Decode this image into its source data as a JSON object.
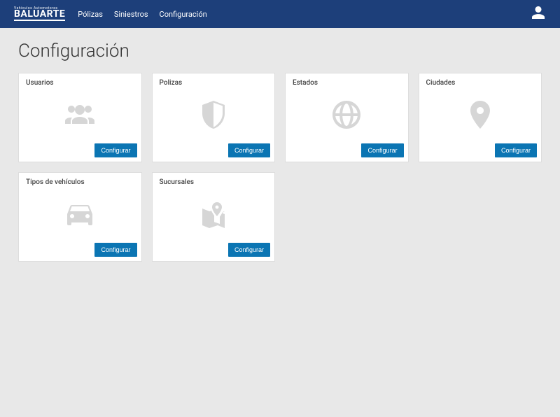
{
  "navbar": {
    "logo_top": "Vehículos Automotores",
    "logo_main": "BALUARTE",
    "links": [
      {
        "label": "Pólizas"
      },
      {
        "label": "Siniestros"
      },
      {
        "label": "Configuración"
      }
    ]
  },
  "page": {
    "title": "Configuración"
  },
  "cards": [
    {
      "title": "Usuarios",
      "icon": "users",
      "button": "Configurar"
    },
    {
      "title": "Polizas",
      "icon": "shield",
      "button": "Configurar"
    },
    {
      "title": "Estados",
      "icon": "globe",
      "button": "Configurar"
    },
    {
      "title": "Ciudades",
      "icon": "pin",
      "button": "Configurar"
    },
    {
      "title": "Tipos de vehículos",
      "icon": "car",
      "button": "Configurar"
    },
    {
      "title": "Sucursales",
      "icon": "map",
      "button": "Configurar"
    }
  ],
  "colors": {
    "navbar": "#1d3f7a",
    "button": "#0b75b3",
    "icon": "#d6d6d6"
  }
}
